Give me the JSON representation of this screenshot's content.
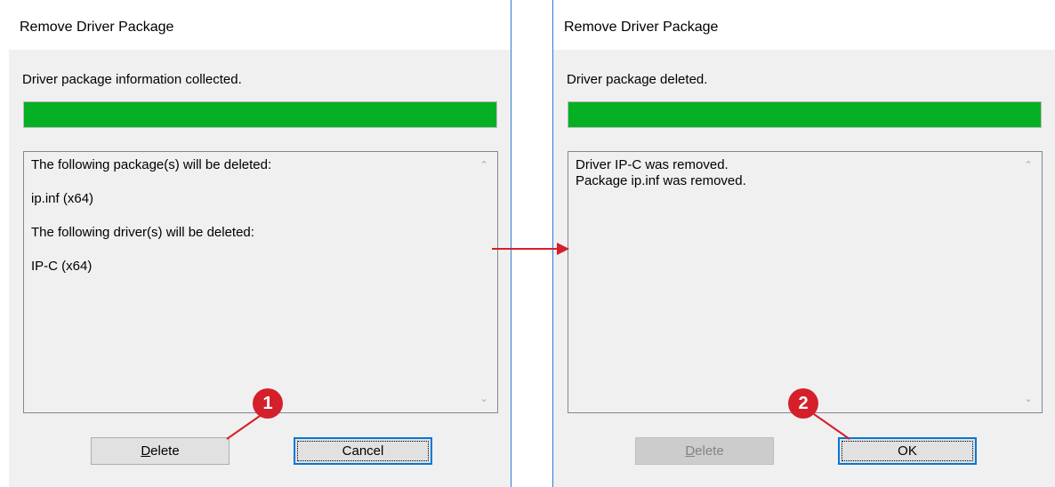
{
  "left_dialog": {
    "title": "Remove Driver Package",
    "status": "Driver package information collected.",
    "progress_fraction": 1.0,
    "list_lines": [
      "The following package(s) will be deleted:",
      "ip.inf (x64)",
      "The following driver(s) will be deleted:",
      "IP-C (x64)"
    ],
    "delete_button": {
      "accel": "D",
      "rest": "elete"
    },
    "cancel_button": "Cancel"
  },
  "right_dialog": {
    "title": "Remove Driver Package",
    "status": "Driver package deleted.",
    "progress_fraction": 1.0,
    "list_lines": [
      "Driver IP-C was removed.",
      "Package ip.inf was removed."
    ],
    "delete_button": {
      "accel": "D",
      "rest": "elete"
    },
    "ok_button": "OK"
  },
  "callouts": [
    "1",
    "2"
  ],
  "colors": {
    "progress": "#06b025",
    "callout": "#d4202b",
    "arrow": "#d4202b",
    "focus": "#0078d7"
  }
}
